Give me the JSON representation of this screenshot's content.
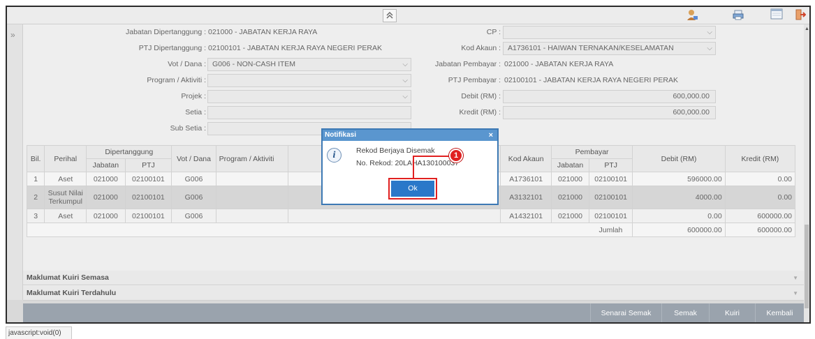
{
  "toolbar": {
    "collapse_glyph": "≈",
    "icons": [
      "user-icon",
      "print-icon",
      "window-icon",
      "logout-icon"
    ]
  },
  "form": {
    "jabatan_dipertanggung": {
      "label": "Jabatan Dipertanggung :",
      "value": "021000 - JABATAN KERJA RAYA"
    },
    "ptj_dipertanggung": {
      "label": "PTJ Dipertanggung :",
      "value": "02100101 - JABATAN KERJA RAYA NEGERI PERAK"
    },
    "vot_dana": {
      "label": "Vot / Dana :",
      "value": "G006 - NON-CASH ITEM"
    },
    "program_aktiviti": {
      "label": "Program / Aktiviti :",
      "value": ""
    },
    "projek": {
      "label": "Projek :",
      "value": ""
    },
    "setia": {
      "label": "Setia :",
      "value": ""
    },
    "sub_setia": {
      "label": "Sub Setia :",
      "value": ""
    },
    "cp": {
      "label": "CP :",
      "value": ""
    },
    "kod_akaun": {
      "label": "Kod Akaun :",
      "value": "A1736101 - HAIWAN TERNAKAN/KESELAMATAN"
    },
    "jabatan_pembayar": {
      "label": "Jabatan Pembayar :",
      "value": "021000 - JABATAN KERJA RAYA"
    },
    "ptj_pembayar": {
      "label": "PTJ Pembayar :",
      "value": "02100101 - JABATAN KERJA RAYA NEGERI PERAK"
    },
    "debit": {
      "label": "Debit (RM) :",
      "value": "600,000.00"
    },
    "kredit": {
      "label": "Kredit (RM) :",
      "value": "600,000.00"
    }
  },
  "table": {
    "headers": {
      "bil": "Bil.",
      "perihal": "Perihal",
      "dipertanggung": "Dipertanggung",
      "jabatan": "Jabatan",
      "ptj": "PTJ",
      "vot_dana": "Vot / Dana",
      "program_aktiviti": "Program / Aktiviti",
      "kod_akaun": "Kod Akaun",
      "pembayar": "Pembayar",
      "jabatan2": "Jabatan",
      "ptj2": "PTJ",
      "debit": "Debit (RM)",
      "kredit": "Kredit (RM)"
    },
    "rows": [
      {
        "bil": "1",
        "perihal": "Aset",
        "jabatan": "021000",
        "ptj": "02100101",
        "vot": "G006",
        "program": "",
        "kod": "A1736101",
        "jabatan2": "021000",
        "ptj2": "02100101",
        "debit": "596000.00",
        "kredit": "0.00"
      },
      {
        "bil": "2",
        "perihal": "Susut Nilai Terkumpul",
        "jabatan": "021000",
        "ptj": "02100101",
        "vot": "G006",
        "program": "",
        "kod": "A3132101",
        "jabatan2": "021000",
        "ptj2": "02100101",
        "debit": "4000.00",
        "kredit": "0.00"
      },
      {
        "bil": "3",
        "perihal": "Aset",
        "jabatan": "021000",
        "ptj": "02100101",
        "vot": "G006",
        "program": "",
        "kod": "A1432101",
        "jabatan2": "021000",
        "ptj2": "02100101",
        "debit": "0.00",
        "kredit": "600000.00"
      }
    ],
    "total": {
      "label": "Jumlah",
      "debit": "600000.00",
      "kredit": "600000.00"
    }
  },
  "accordions": {
    "semasa": "Maklumat Kuiri Semasa",
    "terdahulu": "Maklumat Kuiri Terdahulu"
  },
  "actions": {
    "senarai_semak": "Senarai Semak",
    "semak": "Semak",
    "kuiri": "Kuiri",
    "kembali": "Kembali"
  },
  "dialog": {
    "title": "Notifikasi",
    "close": "×",
    "message": "Rekod Berjaya Disemak",
    "record": "No. Rekod: 20LAHA130100037",
    "ok": "Ok"
  },
  "callout": "1",
  "status_text": "javascript:void(0)",
  "colors": {
    "dialog_header": "#5a96cf",
    "ok_button": "#2a78c9",
    "highlight": "#e02020",
    "action_bar": "#9aa3ad"
  }
}
